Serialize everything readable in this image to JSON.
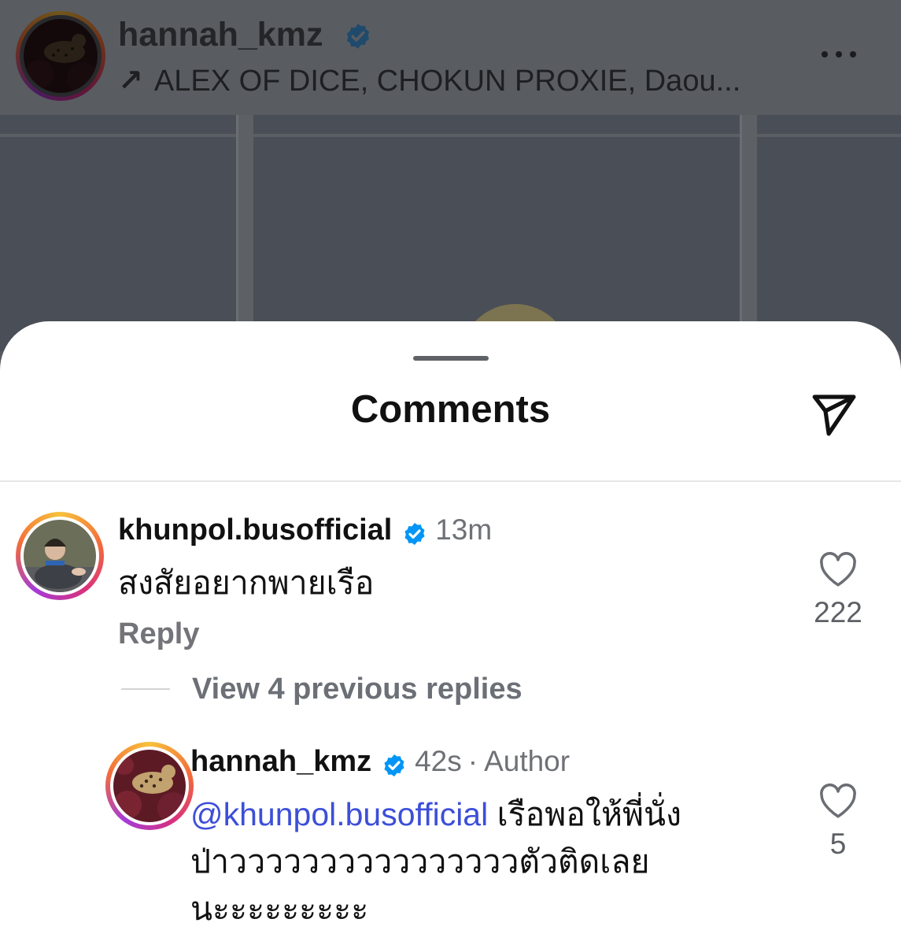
{
  "post": {
    "username": "hannah_kmz",
    "collaborators": "ALEX OF DICE, CHOKUN PROXIE, Daou...",
    "collab_arrow": "↗"
  },
  "sheet": {
    "title": "Comments"
  },
  "comments": [
    {
      "username": "khunpol.busofficial",
      "time": "13m",
      "text": "สงสัยอยากพายเรือ",
      "reply_label": "Reply",
      "likes": "222",
      "view_replies": "View 4 previous replies"
    },
    {
      "username": "hannah_kmz",
      "time": "42s",
      "separator": "·",
      "author_label": "Author",
      "mention": "@khunpol.busofficial",
      "text_line1": "เรือพอให้พี่นั่ง",
      "text_line2": "ป่าววววววววววววววววตัวติดเลย",
      "text_line3": "นะะะะะะะะะ",
      "likes": "5"
    }
  ],
  "colors": {
    "verified": "#0095f6",
    "mention": "#3c4fd8",
    "secondary_text": "#6e7176"
  },
  "icons": [
    "verified-badge-icon",
    "more-options-icon",
    "share-paper-plane-icon",
    "heart-icon"
  ]
}
